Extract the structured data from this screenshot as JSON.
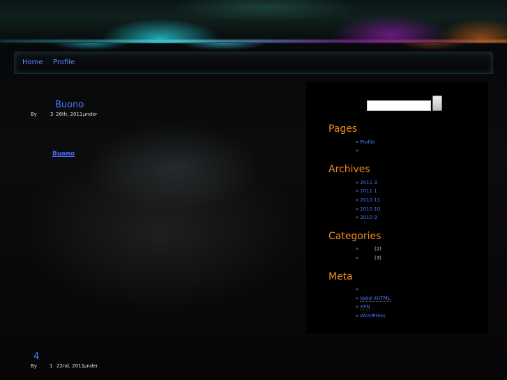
{
  "nav": {
    "items": [
      "Home",
      "Profile"
    ]
  },
  "posts": [
    {
      "title": "Buono",
      "meta": {
        "by": "By",
        "month": "3",
        "date": "26th, 2011,",
        "under": "under"
      },
      "more_link": "Buono"
    },
    {
      "title": "4",
      "meta": {
        "by": "By",
        "month": "1",
        "date": "22nd, 2011,",
        "under": "under"
      }
    }
  ],
  "sidebar": {
    "search": {
      "value": "",
      "button_label": ""
    },
    "pages": {
      "title": "Pages",
      "items": [
        "Profile",
        ""
      ]
    },
    "archives": {
      "title": "Archives",
      "items": [
        "2011  3",
        "2011  1",
        "2010 11",
        "2010 10",
        "2010 9"
      ]
    },
    "categories": {
      "title": "Categories",
      "items": [
        {
          "label": "",
          "count": "(2)"
        },
        {
          "label": "",
          "count": "(3)"
        }
      ]
    },
    "meta": {
      "title": "Meta",
      "items": [
        "",
        "Valid XHTML",
        "XFN",
        "WordPress"
      ]
    },
    "bullet": "»"
  },
  "colors": {
    "link": "#4a78ff",
    "widget_title": "#f08c1c",
    "background": "#060607"
  }
}
